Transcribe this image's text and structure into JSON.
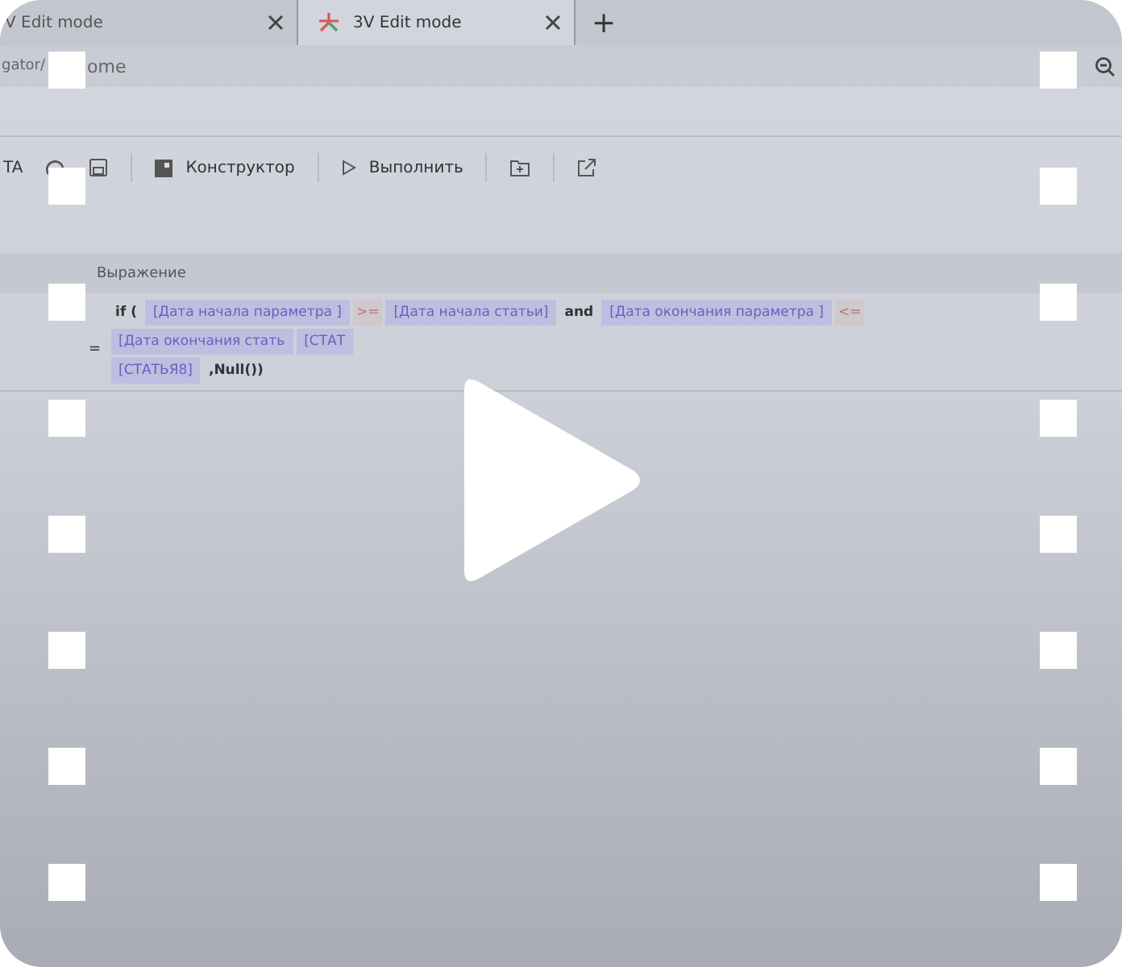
{
  "tabs": [
    {
      "label": "V Edit mode",
      "selected": false,
      "has_logo": false
    },
    {
      "label": "3V Edit mode",
      "selected": true,
      "has_logo": true
    }
  ],
  "new_tab": "+",
  "address": {
    "parts": [
      "gator/",
      "ome"
    ]
  },
  "toolbar": [
    {
      "kind": "text",
      "label": "TA"
    },
    {
      "kind": "redo"
    },
    {
      "kind": "save"
    },
    {
      "kind": "sep"
    },
    {
      "kind": "constructor",
      "label": "Конструктор"
    },
    {
      "kind": "sep"
    },
    {
      "kind": "run",
      "label": "Выполнить"
    },
    {
      "kind": "sep"
    },
    {
      "kind": "folder"
    },
    {
      "kind": "sep"
    },
    {
      "kind": "export"
    }
  ],
  "expression": {
    "header": "Выражение",
    "eq": "=",
    "lines": [
      [
        {
          "kind": "text",
          "text": "if ("
        },
        {
          "kind": "field",
          "text": "[Дата начала параметра ]"
        },
        {
          "kind": "op",
          "text": ">="
        },
        {
          "kind": "field",
          "text": "[Дата начала статьи]"
        },
        {
          "kind": "text",
          "text": "and"
        },
        {
          "kind": "field",
          "text": "[Дата окончания параметра ]"
        },
        {
          "kind": "op",
          "text": "<="
        },
        {
          "kind": "field",
          "text": "[Дата окончания стать"
        },
        {
          "kind": "field",
          "text": "[СТАТ"
        }
      ],
      [
        {
          "kind": "field",
          "text": "[СТАТЬЯ8]"
        },
        {
          "kind": "text",
          "text": ",Null())"
        }
      ]
    ]
  }
}
